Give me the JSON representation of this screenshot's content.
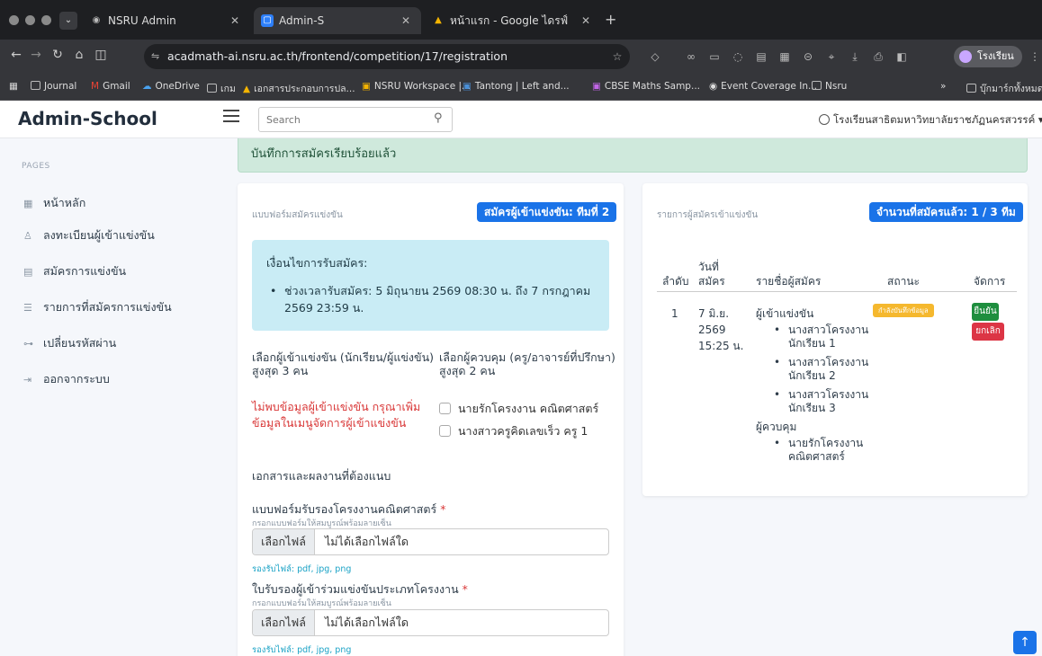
{
  "browser": {
    "tabs": [
      {
        "title": "NSRU Admin"
      },
      {
        "title": "Admin-S"
      },
      {
        "title": "หน้าแรก - Google ไดรฟ์"
      }
    ],
    "url": "acadmath-ai.nsru.ac.th/frontend/competition/17/registration",
    "profile": "โรงเรียน",
    "bookmarks": [
      "Journal",
      "Gmail",
      "OneDrive",
      "เกม",
      "เอกสารประกอบการปล...",
      "NSRU Workspace |...",
      "Tantong | Left and...",
      "CBSE Maths Samp...",
      "Event Coverage In...",
      "Nsru",
      "บุ๊กมาร์กทั้งหมด"
    ]
  },
  "app": {
    "brand": "Admin-School",
    "search_placeholder": "Search",
    "school_name": "โรงเรียนสาธิตมหาวิทยาลัยราชภัฏนครสวรรค์",
    "sidebar": {
      "section": "PAGES",
      "items": [
        {
          "label": "หน้าหลัก"
        },
        {
          "label": "ลงทะเบียนผู้เข้าแข่งขัน"
        },
        {
          "label": "สมัครการแข่งขัน"
        },
        {
          "label": "รายการที่สมัครการแข่งขัน"
        },
        {
          "label": "เปลี่ยนรหัสผ่าน"
        },
        {
          "label": "ออกจากระบบ"
        }
      ]
    },
    "alert": "บันทึกการสมัครเรียบร้อยแล้ว",
    "form": {
      "title": "แบบฟอร์มสมัครแข่งขัน",
      "team_badge": "สมัครผู้เข้าแข่งขัน: ทีมที่ 2",
      "conditions_title": "เงื่อนไขการรับสมัคร:",
      "conditions_item": "ช่วงเวลารับสมัคร: 5 มิถุนายน 2569 08:30 น. ถึง 7 กรกฎาคม 2569 23:59 น.",
      "contestant_label": "เลือกผู้เข้าแข่งขัน (นักเรียน/ผู้แข่งขัน) สูงสุด 3 คน",
      "supervisor_label": "เลือกผู้ควบคุม (ครู/อาจารย์ที่ปรึกษา) สูงสุด 2 คน",
      "contestant_error": "ไม่พบข้อมูลผู้เข้าแข่งขัน กรุณาเพิ่มข้อมูลในเมนูจัดการผู้เข้าแข่งขัน",
      "supervisors": [
        {
          "name": "นายรักโครงงาน คณิตศาสตร์"
        },
        {
          "name": "นางสาวครูคิดเลขเร็ว ครู 1"
        }
      ],
      "docs_heading": "เอกสารและผลงานที่ต้องแนบ",
      "doc1_label": "แบบฟอร์มรับรองโครงงานคณิตศาสตร์",
      "doc1_hint": "กรอกแบบฟอร์มให้สมบูรณ์พร้อมลายเซ็น",
      "doc2_label": "ใบรับรองผู้เข้าร่วมแข่งขันประเภทโครงงาน",
      "doc2_hint": "กรอกแบบฟอร์มให้สมบูรณ์พร้อมลายเซ็น",
      "required_mark": "*",
      "file_button": "เลือกไฟล์",
      "file_none": "ไม่ได้เลือกไฟล์ใด",
      "accepted": "รองรับไฟล์: pdf, jpg, png"
    },
    "list": {
      "title": "รายการผู้สมัครเข้าแข่งขัน",
      "count_badge": "จำนวนที่สมัครแล้ว: 1 / 3 ทีม",
      "headers": {
        "no": "ลำดับ",
        "date_1": "วันที่",
        "date_2": "สมัคร",
        "names": "รายชื่อผู้สมัคร",
        "status": "สถานะ",
        "manage": "จัดการ"
      },
      "row": {
        "no": "1",
        "date_1": "7 มิ.ย.",
        "date_2": "2569",
        "time": "15:25 น.",
        "contestants_heading": "ผู้เข้าแข่งขัน",
        "contestants": [
          "นางสาวโครงงาน นักเรียน 1",
          "นางสาวโครงงาน นักเรียน 2",
          "นางสาวโครงงาน นักเรียน 3"
        ],
        "supervisors_heading": "ผู้ควบคุม",
        "supervisors": [
          "นายรักโครงงาน คณิตศาสตร์"
        ],
        "status": "กำลังบันทึกข้อมูล",
        "confirm": "ยืนยัน",
        "cancel": "ยกเลิก"
      }
    },
    "colors": {
      "primary": "#1a73e8",
      "success": "#1e8e3e",
      "danger": "#dc3545",
      "warning": "#f5b82e",
      "alert_bg": "#cfe9dc",
      "info_bg": "#c9ecf5"
    }
  }
}
